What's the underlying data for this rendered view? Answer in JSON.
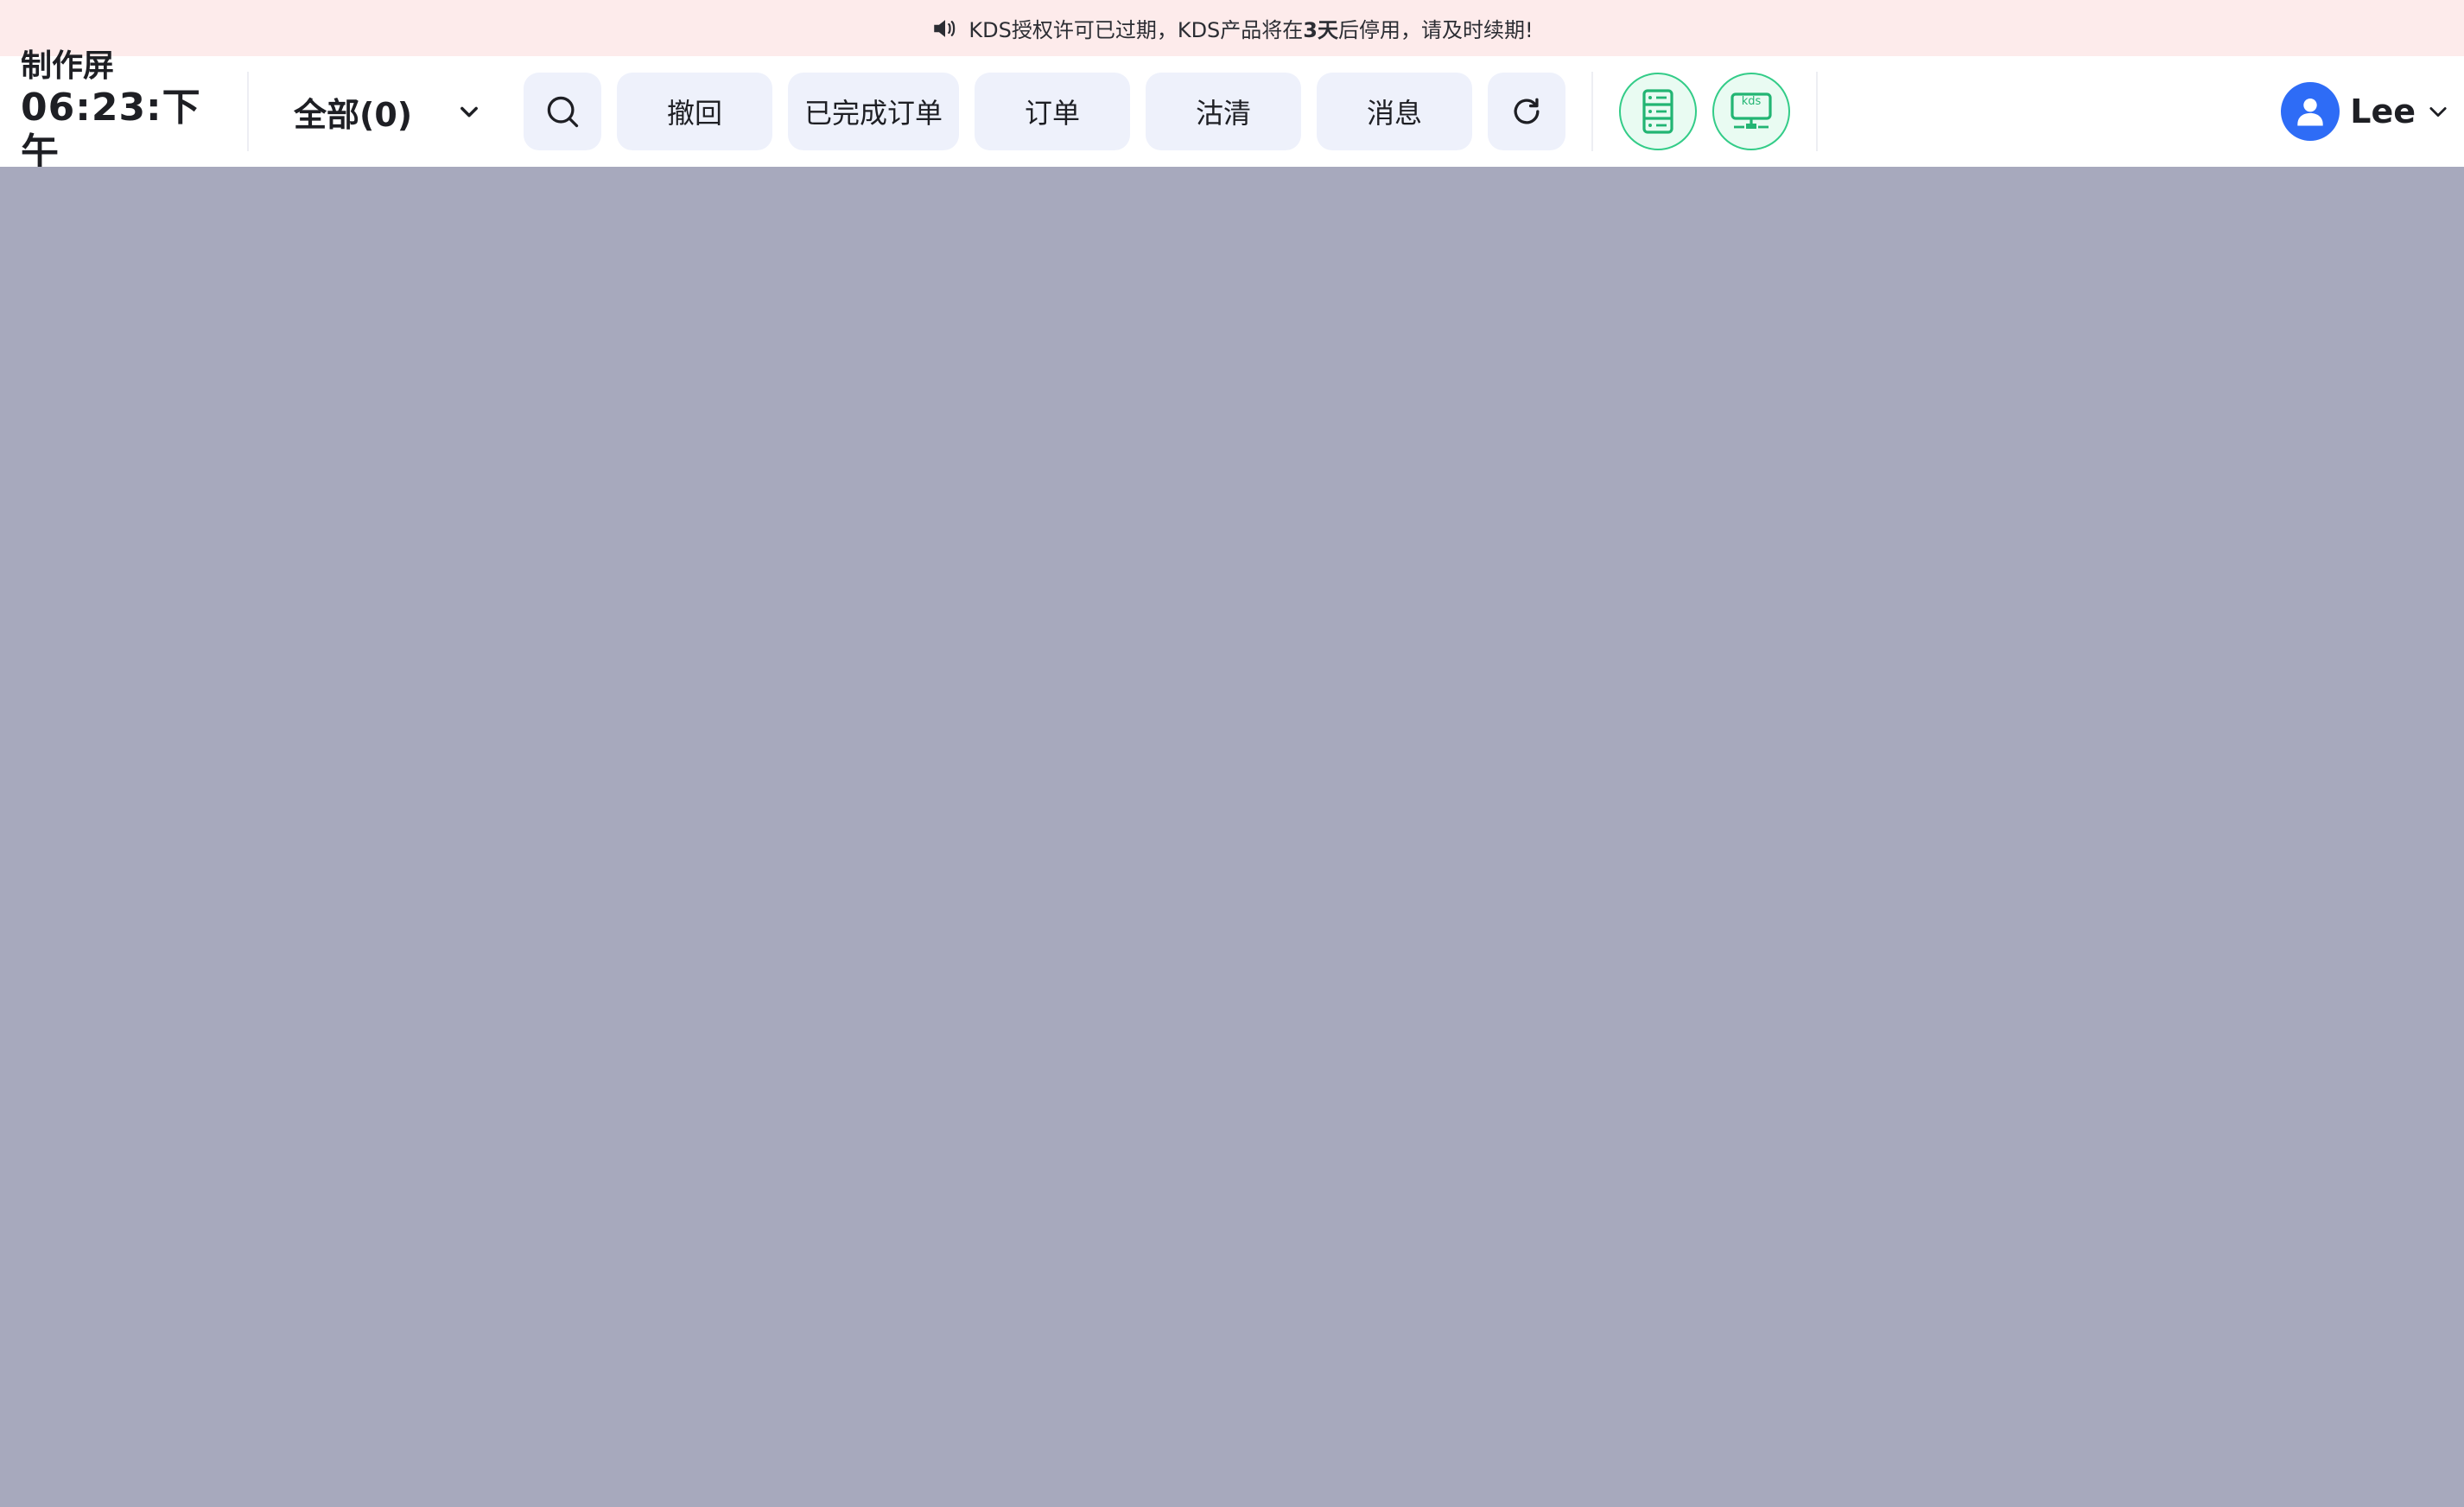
{
  "banner": {
    "prefix": "KDS授权许可已过期，KDS产品将在",
    "highlight": "3天",
    "suffix": "后停用，请及时续期!",
    "icon": "speaker-icon"
  },
  "header": {
    "title": "制作屏",
    "clock": "06:23:下午"
  },
  "filter": {
    "label": "全部(0)",
    "icon": "chevron-down-icon"
  },
  "toolbar": {
    "search_icon": "search-icon",
    "buttons": [
      {
        "label": "撤回"
      },
      {
        "label": "已完成订单"
      },
      {
        "label": "订单"
      },
      {
        "label": "沽清"
      },
      {
        "label": "消息"
      }
    ],
    "refresh_icon": "refresh-icon",
    "device_icons": [
      "server-icon",
      "kds-monitor-icon"
    ],
    "kds_text": "kds"
  },
  "user": {
    "name": "Lee",
    "avatar_icon": "user-avatar-icon",
    "menu_icon": "chevron-down-icon"
  },
  "colors": {
    "banner_bg": "#FDEBEB",
    "pill_bg": "#EEF1FB",
    "accent_green": "#33CC88",
    "accent_blue": "#2E6CF6",
    "workspace_bg": "#A7A9BD"
  }
}
